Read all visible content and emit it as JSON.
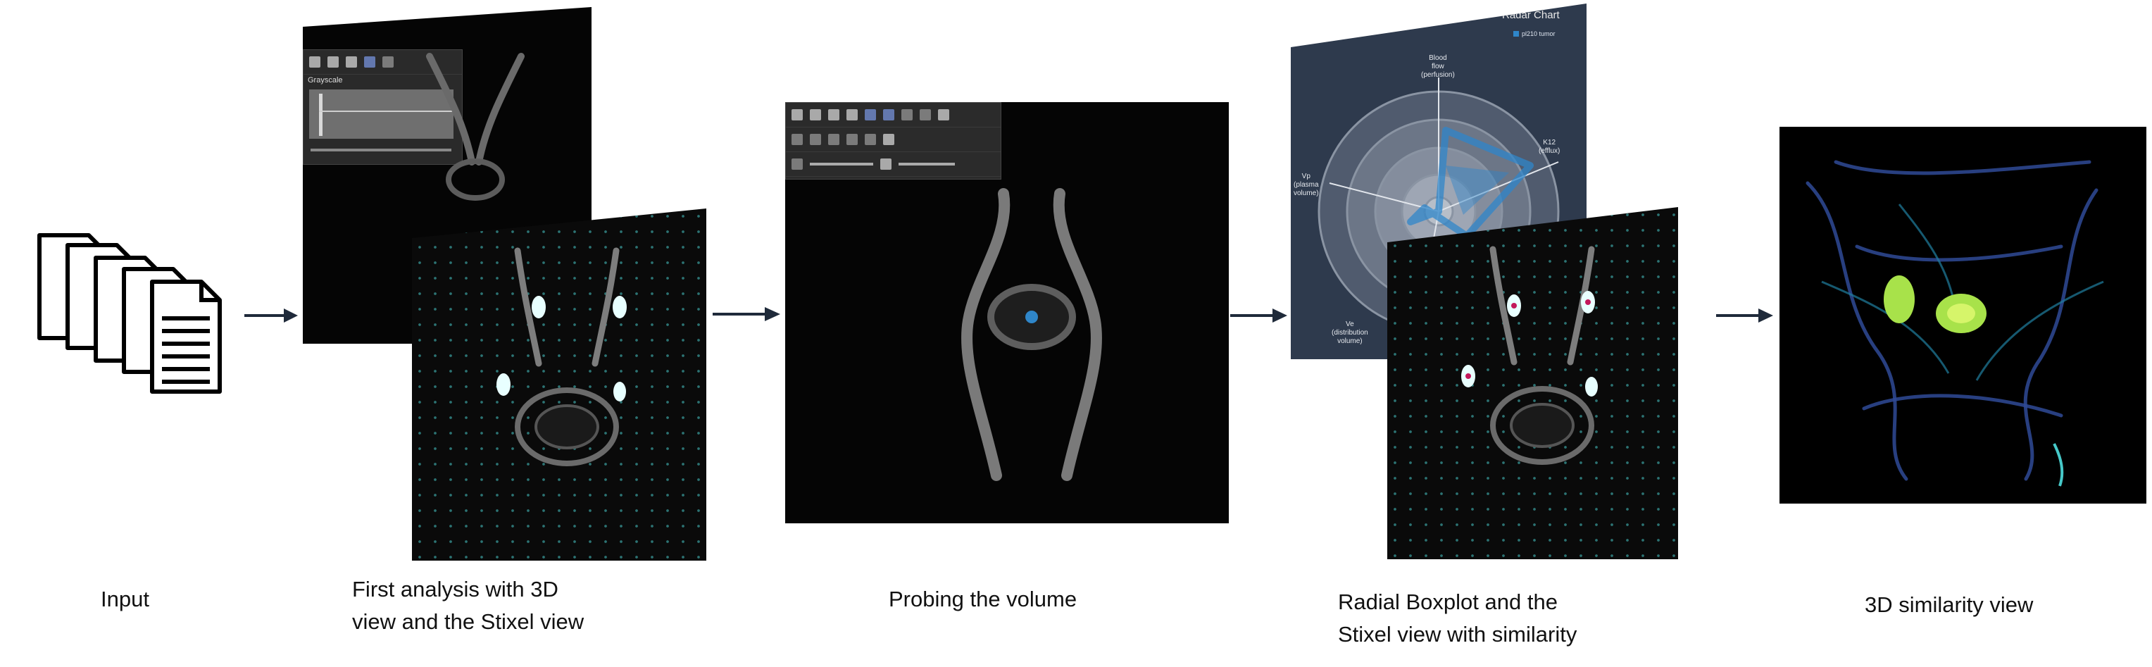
{
  "captions": {
    "input": "Input",
    "first_line1": "First analysis with 3D",
    "first_line2": "view and the Stixel view",
    "probing": "Probing the volume",
    "radial_line1": "Radial Boxplot and the",
    "radial_line2": "Stixel view with similarity",
    "similarity": "3D similarity view"
  },
  "first_panel": {
    "colormap_label": "Grayscale"
  },
  "radar": {
    "title": "Radar Chart",
    "legend_label": "pl210 tumor",
    "axis_labels": {
      "top": [
        "Blood",
        "flow",
        "(perfusion)"
      ],
      "right": [
        "K12",
        "(efflux)"
      ],
      "left": [
        "Vp",
        "(plasma",
        "volume)"
      ],
      "bottom": [
        "Ve",
        "(distribution",
        "volume)"
      ]
    }
  },
  "colors": {
    "arrow": "#1f2a3a",
    "panel_bg": "#050505",
    "radar_bg": "#2e3a4d",
    "radar_series": "#2f86c9",
    "stixel_dots": "#46c8c8",
    "similarity_green": "#a8e24a",
    "similarity_blue": "#3a58a8"
  }
}
